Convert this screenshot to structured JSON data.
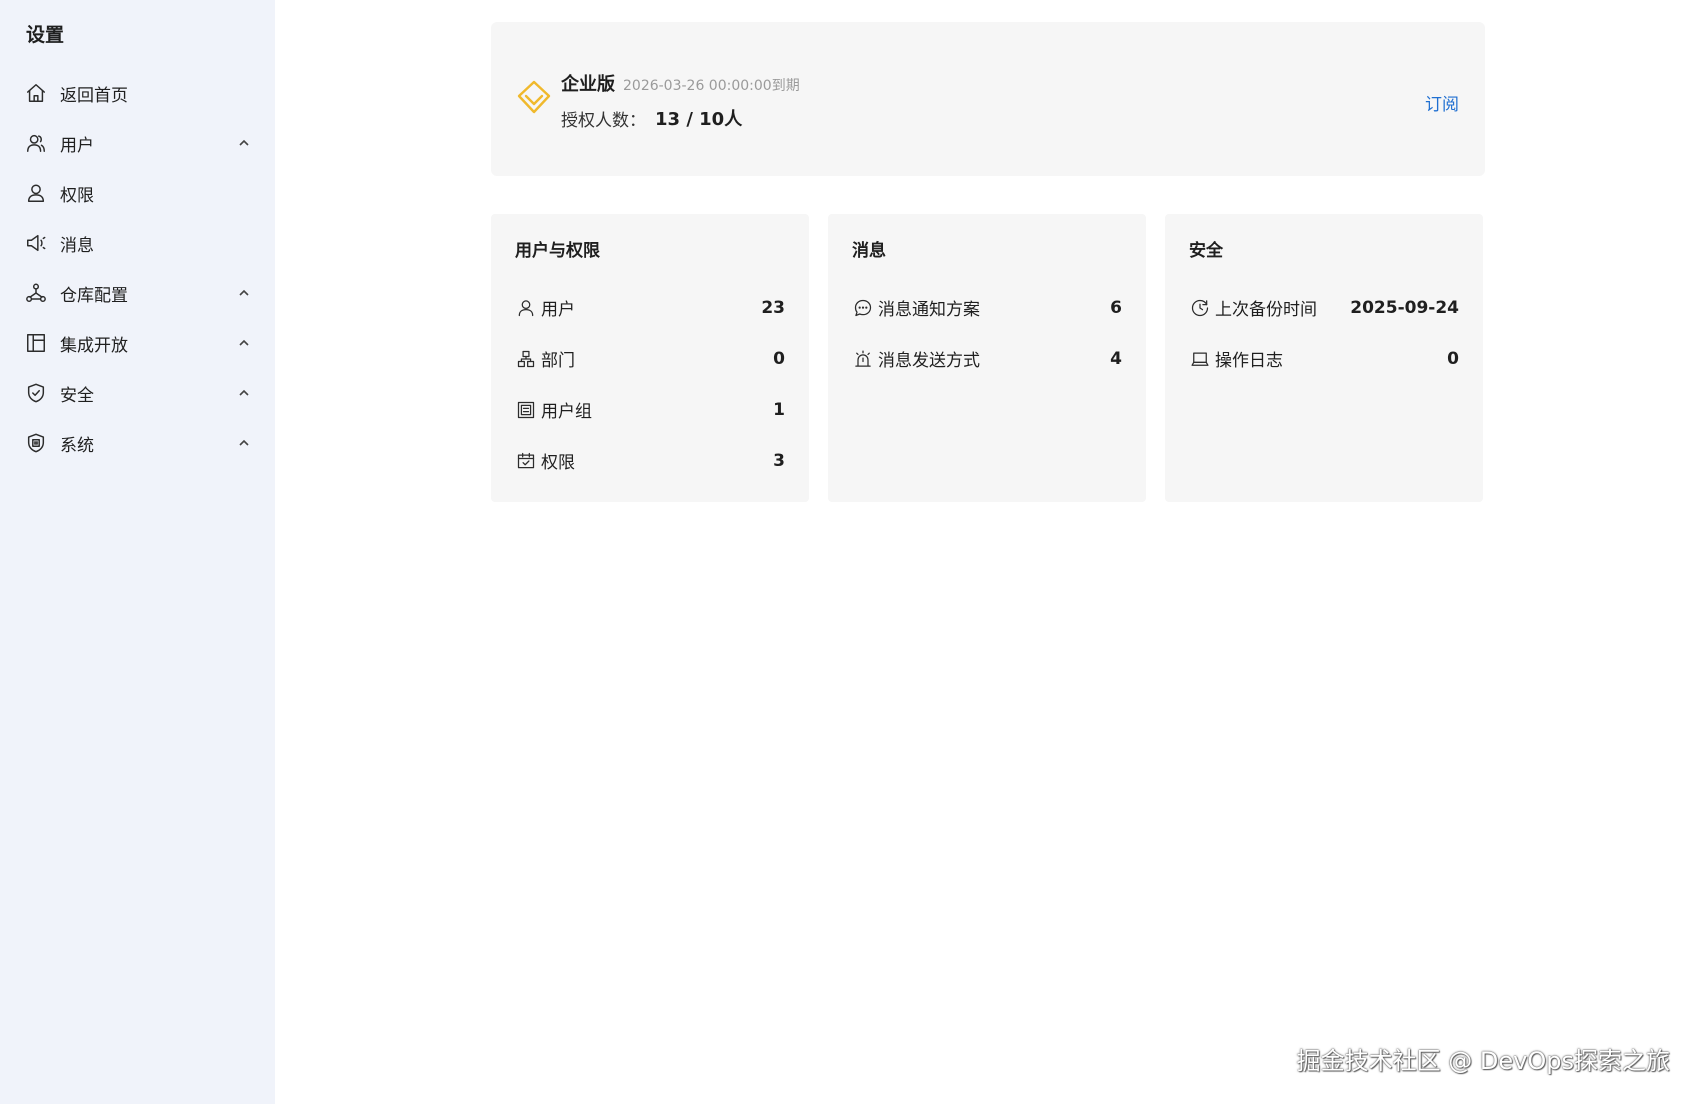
{
  "sidebar": {
    "title": "设置",
    "items": [
      {
        "label": "返回首页",
        "icon": "home-icon",
        "expandable": false
      },
      {
        "label": "用户",
        "icon": "users-icon",
        "expandable": true
      },
      {
        "label": "权限",
        "icon": "user-icon",
        "expandable": false
      },
      {
        "label": "消息",
        "icon": "megaphone-icon",
        "expandable": false
      },
      {
        "label": "仓库配置",
        "icon": "repository-icon",
        "expandable": true
      },
      {
        "label": "集成开放",
        "icon": "layout-icon",
        "expandable": true
      },
      {
        "label": "安全",
        "icon": "shield-check-icon",
        "expandable": true
      },
      {
        "label": "系统",
        "icon": "shield-settings-icon",
        "expandable": true
      }
    ]
  },
  "license": {
    "edition": "企业版",
    "expire": "2026-03-26 00:00:00到期",
    "seats_label": "授权人数：",
    "seats_value": "13 / 10人",
    "subscribe_label": "订阅",
    "icon": "diamond-icon",
    "accent_color": "#f0b92c"
  },
  "cards": {
    "users": {
      "title": "用户与权限",
      "rows": [
        {
          "label": "用户",
          "value": "23",
          "icon": "user-icon"
        },
        {
          "label": "部门",
          "value": "0",
          "icon": "org-chart-icon"
        },
        {
          "label": "用户组",
          "value": "1",
          "icon": "group-icon"
        },
        {
          "label": "权限",
          "value": "3",
          "icon": "permission-icon"
        }
      ]
    },
    "messages": {
      "title": "消息",
      "rows": [
        {
          "label": "消息通知方案",
          "value": "6",
          "icon": "chat-icon"
        },
        {
          "label": "消息发送方式",
          "value": "4",
          "icon": "alarm-icon"
        }
      ]
    },
    "security": {
      "title": "安全",
      "rows": [
        {
          "label": "上次备份时间",
          "value": "2025-09-24",
          "icon": "clock-icon"
        },
        {
          "label": "操作日志",
          "value": "0",
          "icon": "laptop-icon"
        }
      ]
    }
  },
  "watermark": "掘金技术社区 @ DevOps探索之旅",
  "colors": {
    "sidebar_bg": "#f0f3fa",
    "card_bg": "#f6f6f6",
    "link": "#1f6fd1"
  }
}
